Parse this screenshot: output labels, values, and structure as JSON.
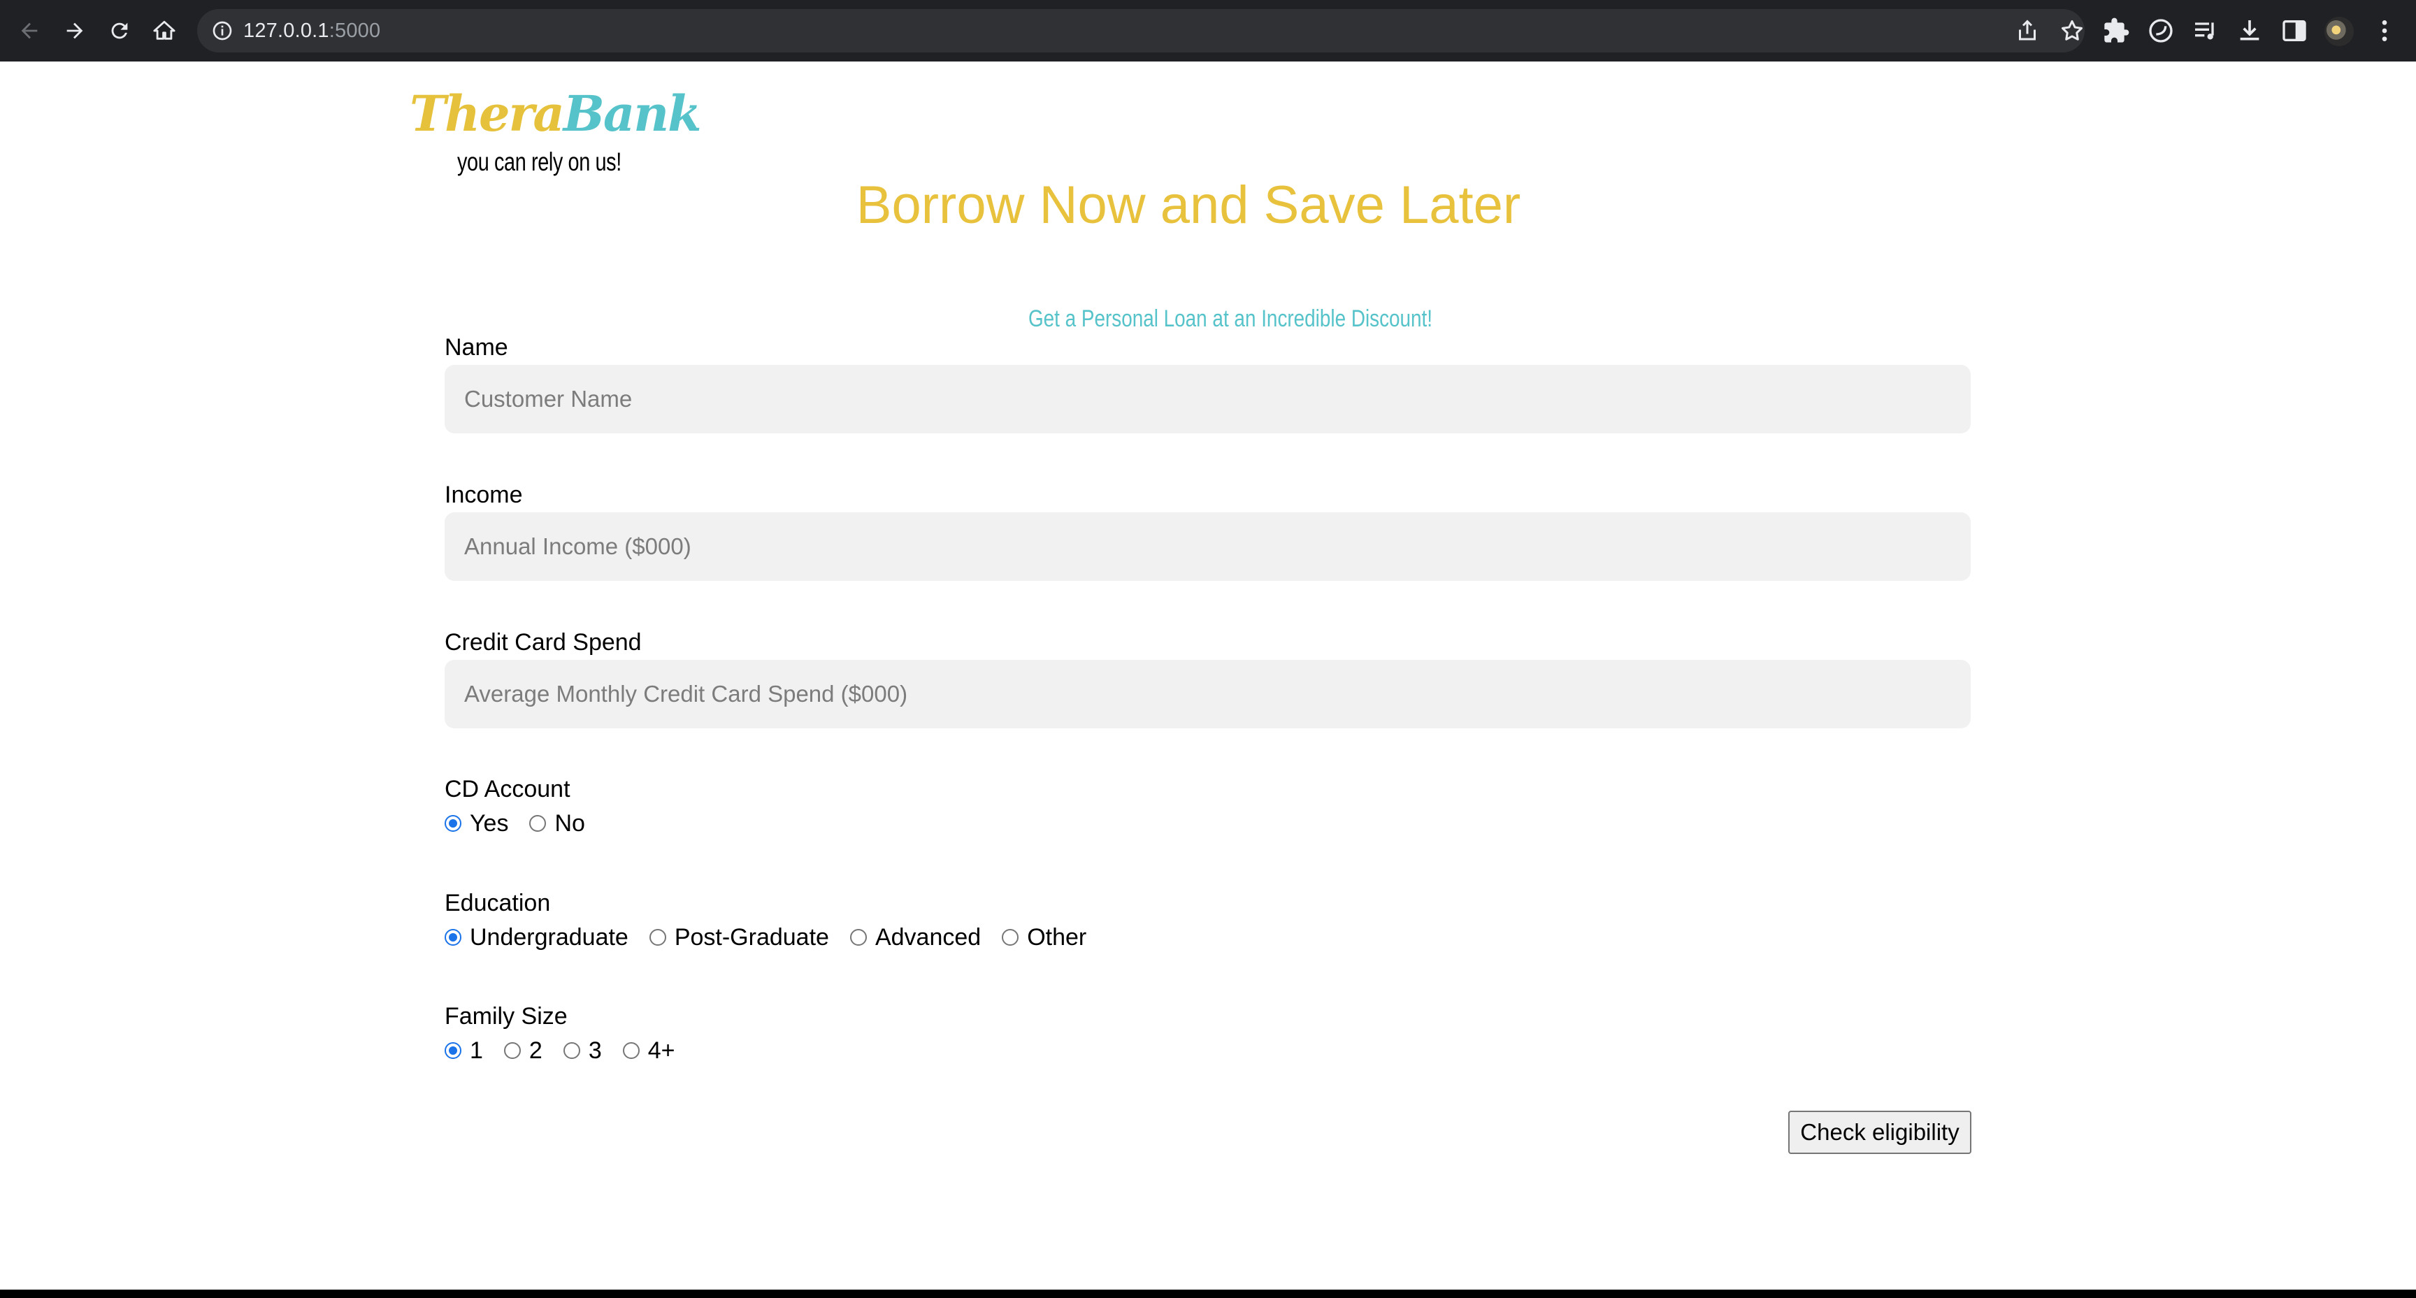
{
  "browser": {
    "url_host": "127.0.0.1",
    "url_port": ":5000"
  },
  "brand": {
    "logo_part1": "Thera",
    "logo_part2": "Bank",
    "tagline": "you can rely on us!",
    "color_gold": "#e8c23d",
    "color_teal": "#55c3c9"
  },
  "hero": {
    "title": "Borrow Now and Save Later",
    "subtitle": "Get a Personal Loan at an Incredible Discount!"
  },
  "form": {
    "name": {
      "label": "Name",
      "placeholder": "Customer Name",
      "value": ""
    },
    "income": {
      "label": "Income",
      "placeholder": "Annual Income ($000)",
      "value": ""
    },
    "ccspend": {
      "label": "Credit Card Spend",
      "placeholder": "Average Monthly Credit Card Spend ($000)",
      "value": ""
    },
    "cd_account": {
      "label": "CD Account",
      "options": [
        "Yes",
        "No"
      ],
      "selected": "Yes"
    },
    "education": {
      "label": "Education",
      "options": [
        "Undergraduate",
        "Post-Graduate",
        "Advanced",
        "Other"
      ],
      "selected": "Undergraduate"
    },
    "family_size": {
      "label": "Family Size",
      "options": [
        "1",
        "2",
        "3",
        "4+"
      ],
      "selected": "1"
    },
    "submit_label": "Check eligibility"
  }
}
